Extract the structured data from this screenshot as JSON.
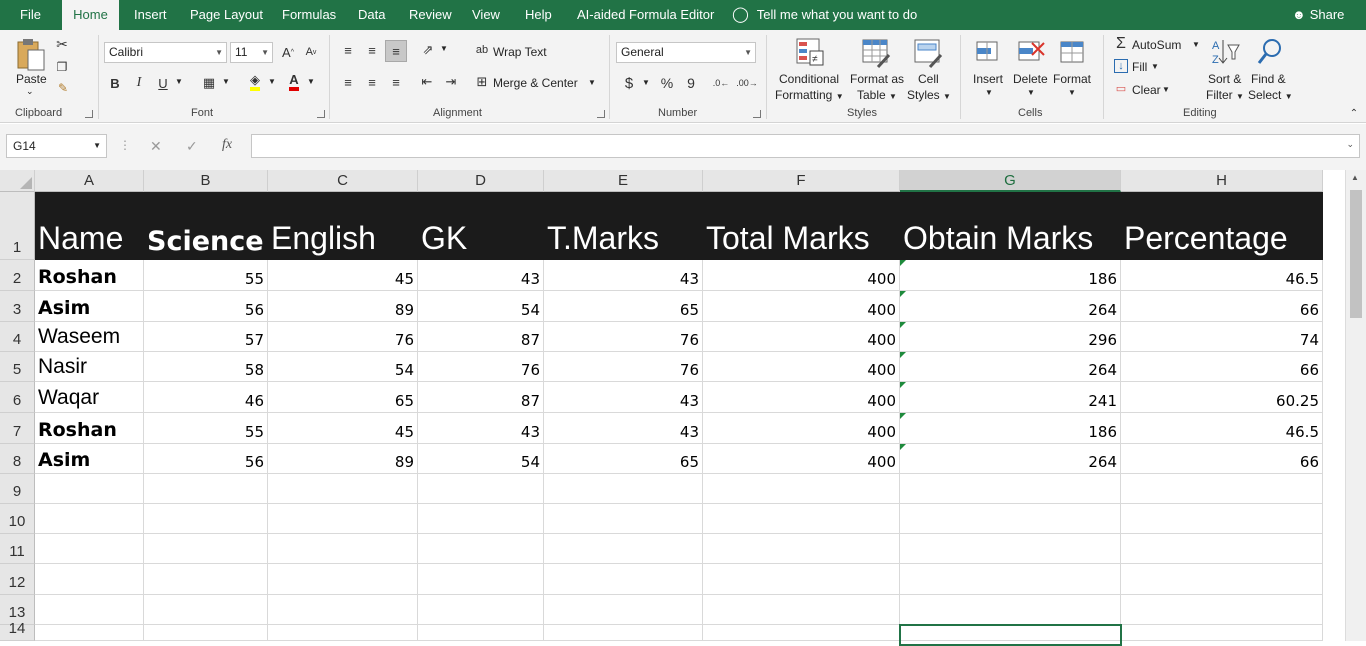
{
  "tabs": [
    {
      "label": "File",
      "active": false
    },
    {
      "label": "Home",
      "active": true
    },
    {
      "label": "Insert",
      "active": false
    },
    {
      "label": "Page Layout",
      "active": false
    },
    {
      "label": "Formulas",
      "active": false
    },
    {
      "label": "Data",
      "active": false
    },
    {
      "label": "Review",
      "active": false
    },
    {
      "label": "View",
      "active": false
    },
    {
      "label": "Help",
      "active": false
    },
    {
      "label": "AI-aided Formula Editor",
      "active": false
    }
  ],
  "tell_me": "Tell me what you want to do",
  "share": "Share",
  "ribbon": {
    "clipboard": {
      "paste": "Paste",
      "label": "Clipboard"
    },
    "font": {
      "name": "Calibri",
      "size": "11",
      "label": "Font",
      "bold": "B",
      "italic": "I",
      "underline": "U"
    },
    "alignment": {
      "wrap": "Wrap Text",
      "merge": "Merge & Center",
      "label": "Alignment"
    },
    "number": {
      "format": "General",
      "currency": "$",
      "percent": "%",
      "comma": "9",
      "label": "Number"
    },
    "styles": {
      "conditional1": "Conditional",
      "conditional2": "Formatting",
      "format_table1": "Format as",
      "format_table2": "Table",
      "cell_styles1": "Cell",
      "cell_styles2": "Styles",
      "label": "Styles"
    },
    "cells": {
      "insert": "Insert",
      "delete": "Delete",
      "format": "Format",
      "label": "Cells"
    },
    "editing": {
      "autosum": "AutoSum",
      "fill": "Fill",
      "clear": "Clear",
      "sort1": "Sort &",
      "sort2": "Filter",
      "find1": "Find &",
      "find2": "Select",
      "label": "Editing"
    }
  },
  "formula_bar": {
    "name_box": "G14",
    "formula": "",
    "fx": "fx"
  },
  "colors": {
    "accent": "#217346",
    "header_bg": "#1b1b1b",
    "error_triangle": "#1e8a3c"
  },
  "columns": [
    "A",
    "B",
    "C",
    "D",
    "E",
    "F",
    "G",
    "H"
  ],
  "selected_column": "G",
  "selected_cell": "G14",
  "rows": [
    "1",
    "2",
    "3",
    "4",
    "5",
    "6",
    "7",
    "8",
    "9",
    "10",
    "11",
    "12",
    "13",
    "14"
  ],
  "sheet": {
    "header": [
      "Name",
      "Science",
      "English",
      "GK",
      "T.Marks",
      "Total Marks",
      "Obtain Marks",
      "Percentage"
    ],
    "data": [
      [
        "Roshan",
        "55",
        "45",
        "43",
        "43",
        "400",
        "186",
        "46.5"
      ],
      [
        "Asim",
        "56",
        "89",
        "54",
        "65",
        "400",
        "264",
        "66"
      ],
      [
        "Waseem",
        "57",
        "76",
        "87",
        "76",
        "400",
        "296",
        "74"
      ],
      [
        "Nasir",
        "58",
        "54",
        "76",
        "76",
        "400",
        "264",
        "66"
      ],
      [
        "Waqar",
        "46",
        "65",
        "87",
        "43",
        "400",
        "241",
        "60.25"
      ],
      [
        "Roshan",
        "55",
        "45",
        "43",
        "43",
        "400",
        "186",
        "46.5"
      ],
      [
        "Asim",
        "56",
        "89",
        "54",
        "65",
        "400",
        "264",
        "66"
      ]
    ],
    "bold_names": [
      true,
      true,
      false,
      false,
      false,
      true,
      true
    ]
  }
}
